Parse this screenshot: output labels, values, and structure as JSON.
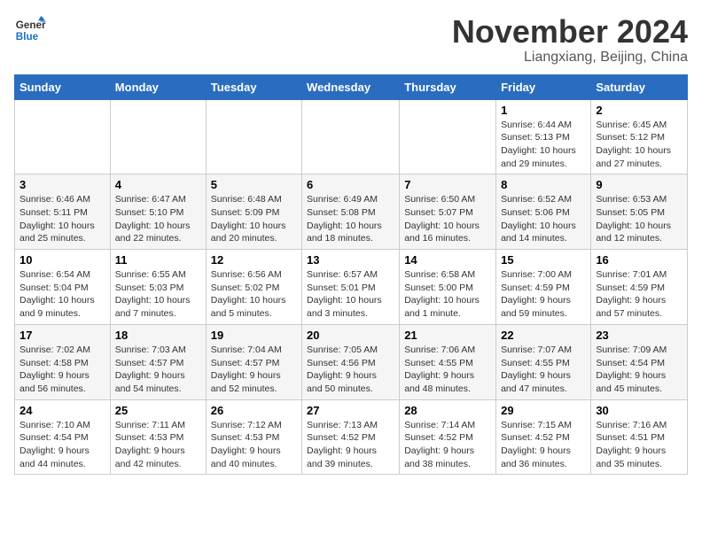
{
  "logo": {
    "general": "General",
    "blue": "Blue"
  },
  "title": "November 2024",
  "location": "Liangxiang, Beijing, China",
  "days_of_week": [
    "Sunday",
    "Monday",
    "Tuesday",
    "Wednesday",
    "Thursday",
    "Friday",
    "Saturday"
  ],
  "weeks": [
    [
      {
        "day": "",
        "detail": ""
      },
      {
        "day": "",
        "detail": ""
      },
      {
        "day": "",
        "detail": ""
      },
      {
        "day": "",
        "detail": ""
      },
      {
        "day": "",
        "detail": ""
      },
      {
        "day": "1",
        "detail": "Sunrise: 6:44 AM\nSunset: 5:13 PM\nDaylight: 10 hours\nand 29 minutes."
      },
      {
        "day": "2",
        "detail": "Sunrise: 6:45 AM\nSunset: 5:12 PM\nDaylight: 10 hours\nand 27 minutes."
      }
    ],
    [
      {
        "day": "3",
        "detail": "Sunrise: 6:46 AM\nSunset: 5:11 PM\nDaylight: 10 hours\nand 25 minutes."
      },
      {
        "day": "4",
        "detail": "Sunrise: 6:47 AM\nSunset: 5:10 PM\nDaylight: 10 hours\nand 22 minutes."
      },
      {
        "day": "5",
        "detail": "Sunrise: 6:48 AM\nSunset: 5:09 PM\nDaylight: 10 hours\nand 20 minutes."
      },
      {
        "day": "6",
        "detail": "Sunrise: 6:49 AM\nSunset: 5:08 PM\nDaylight: 10 hours\nand 18 minutes."
      },
      {
        "day": "7",
        "detail": "Sunrise: 6:50 AM\nSunset: 5:07 PM\nDaylight: 10 hours\nand 16 minutes."
      },
      {
        "day": "8",
        "detail": "Sunrise: 6:52 AM\nSunset: 5:06 PM\nDaylight: 10 hours\nand 14 minutes."
      },
      {
        "day": "9",
        "detail": "Sunrise: 6:53 AM\nSunset: 5:05 PM\nDaylight: 10 hours\nand 12 minutes."
      }
    ],
    [
      {
        "day": "10",
        "detail": "Sunrise: 6:54 AM\nSunset: 5:04 PM\nDaylight: 10 hours\nand 9 minutes."
      },
      {
        "day": "11",
        "detail": "Sunrise: 6:55 AM\nSunset: 5:03 PM\nDaylight: 10 hours\nand 7 minutes."
      },
      {
        "day": "12",
        "detail": "Sunrise: 6:56 AM\nSunset: 5:02 PM\nDaylight: 10 hours\nand 5 minutes."
      },
      {
        "day": "13",
        "detail": "Sunrise: 6:57 AM\nSunset: 5:01 PM\nDaylight: 10 hours\nand 3 minutes."
      },
      {
        "day": "14",
        "detail": "Sunrise: 6:58 AM\nSunset: 5:00 PM\nDaylight: 10 hours\nand 1 minute."
      },
      {
        "day": "15",
        "detail": "Sunrise: 7:00 AM\nSunset: 4:59 PM\nDaylight: 9 hours\nand 59 minutes."
      },
      {
        "day": "16",
        "detail": "Sunrise: 7:01 AM\nSunset: 4:59 PM\nDaylight: 9 hours\nand 57 minutes."
      }
    ],
    [
      {
        "day": "17",
        "detail": "Sunrise: 7:02 AM\nSunset: 4:58 PM\nDaylight: 9 hours\nand 56 minutes."
      },
      {
        "day": "18",
        "detail": "Sunrise: 7:03 AM\nSunset: 4:57 PM\nDaylight: 9 hours\nand 54 minutes."
      },
      {
        "day": "19",
        "detail": "Sunrise: 7:04 AM\nSunset: 4:57 PM\nDaylight: 9 hours\nand 52 minutes."
      },
      {
        "day": "20",
        "detail": "Sunrise: 7:05 AM\nSunset: 4:56 PM\nDaylight: 9 hours\nand 50 minutes."
      },
      {
        "day": "21",
        "detail": "Sunrise: 7:06 AM\nSunset: 4:55 PM\nDaylight: 9 hours\nand 48 minutes."
      },
      {
        "day": "22",
        "detail": "Sunrise: 7:07 AM\nSunset: 4:55 PM\nDaylight: 9 hours\nand 47 minutes."
      },
      {
        "day": "23",
        "detail": "Sunrise: 7:09 AM\nSunset: 4:54 PM\nDaylight: 9 hours\nand 45 minutes."
      }
    ],
    [
      {
        "day": "24",
        "detail": "Sunrise: 7:10 AM\nSunset: 4:54 PM\nDaylight: 9 hours\nand 44 minutes."
      },
      {
        "day": "25",
        "detail": "Sunrise: 7:11 AM\nSunset: 4:53 PM\nDaylight: 9 hours\nand 42 minutes."
      },
      {
        "day": "26",
        "detail": "Sunrise: 7:12 AM\nSunset: 4:53 PM\nDaylight: 9 hours\nand 40 minutes."
      },
      {
        "day": "27",
        "detail": "Sunrise: 7:13 AM\nSunset: 4:52 PM\nDaylight: 9 hours\nand 39 minutes."
      },
      {
        "day": "28",
        "detail": "Sunrise: 7:14 AM\nSunset: 4:52 PM\nDaylight: 9 hours\nand 38 minutes."
      },
      {
        "day": "29",
        "detail": "Sunrise: 7:15 AM\nSunset: 4:52 PM\nDaylight: 9 hours\nand 36 minutes."
      },
      {
        "day": "30",
        "detail": "Sunrise: 7:16 AM\nSunset: 4:51 PM\nDaylight: 9 hours\nand 35 minutes."
      }
    ]
  ]
}
